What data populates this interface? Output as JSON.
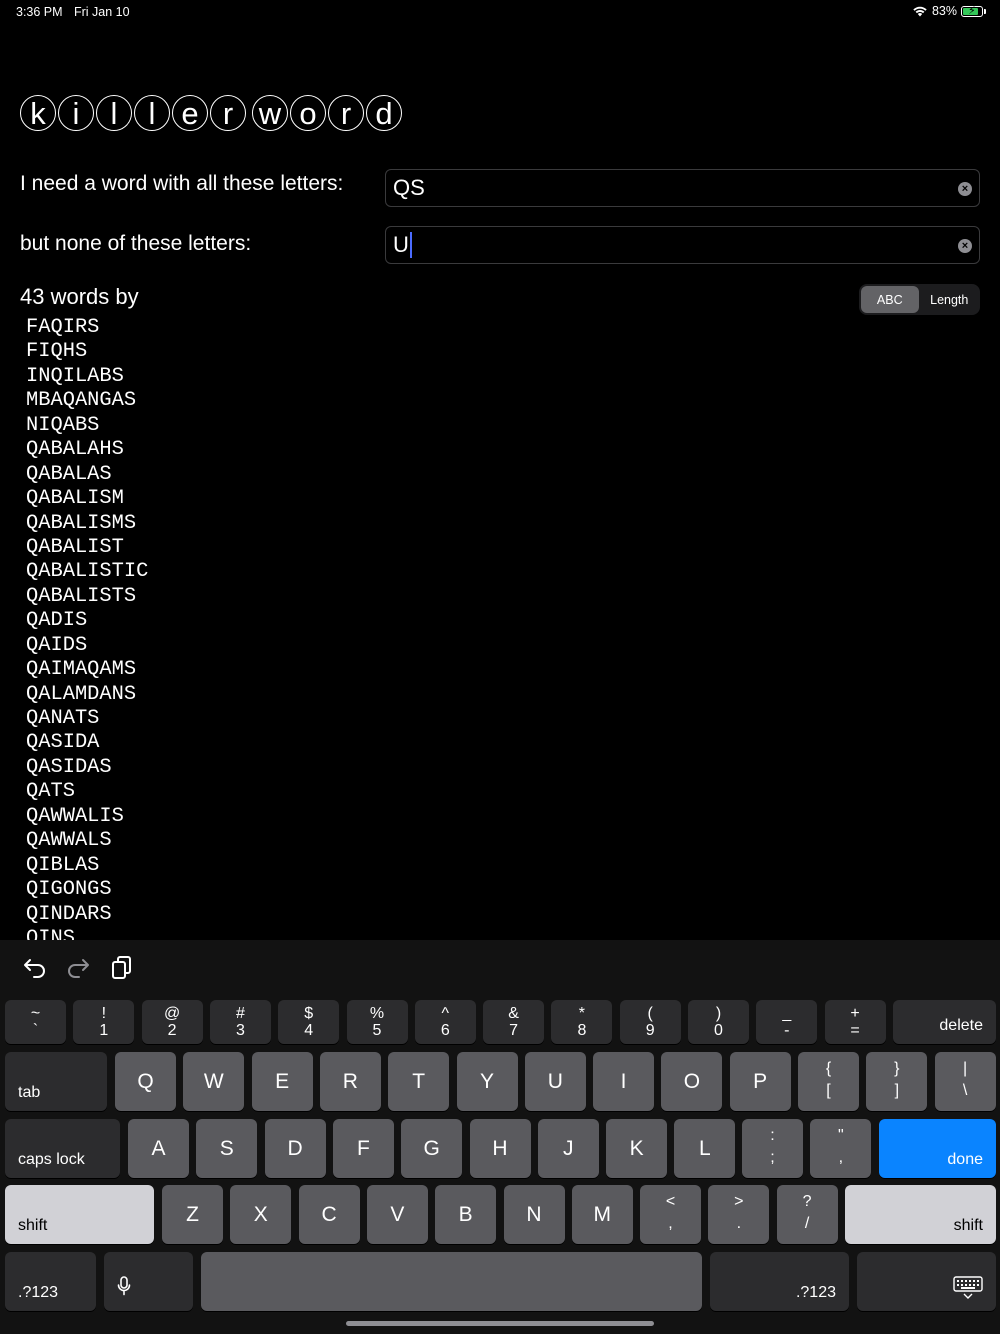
{
  "status": {
    "time": "3:36 PM",
    "date": "Fri Jan 10",
    "battery": "83%",
    "wifi_icon": "wifi-icon",
    "battery_icon": "battery-charging-icon"
  },
  "title_letters": [
    [
      "k",
      "i",
      "l",
      "l",
      "e",
      "r"
    ],
    [
      "w",
      "o",
      "r",
      "d"
    ]
  ],
  "form": {
    "include_label": "I need a word with all these letters:",
    "include_value": "QS",
    "exclude_label": "but none of these letters:",
    "exclude_value": "U"
  },
  "results": {
    "count_text": "43 words by",
    "sort_options": [
      "ABC",
      "Length"
    ],
    "selected_sort": "ABC",
    "words": [
      "FAQIRS",
      "FIQHS",
      "INQILABS",
      "MBAQANGAS",
      "NIQABS",
      "QABALAHS",
      "QABALAS",
      "QABALISM",
      "QABALISMS",
      "QABALIST",
      "QABALISTIC",
      "QABALISTS",
      "QADIS",
      "QAIDS",
      "QAIMAQAMS",
      "QALAMDANS",
      "QANATS",
      "QASIDA",
      "QASIDAS",
      "QATS",
      "QAWWALIS",
      "QAWWALS",
      "QIBLAS",
      "QIGONGS",
      "QINDARS",
      "QINS"
    ]
  },
  "keyboard": {
    "toolbar_icons": [
      "undo-icon",
      "redo-icon",
      "paste-icon"
    ],
    "row1": [
      {
        "t": "~",
        "b": "`"
      },
      {
        "t": "!",
        "b": "1"
      },
      {
        "t": "@",
        "b": "2"
      },
      {
        "t": "#",
        "b": "3"
      },
      {
        "t": "$",
        "b": "4"
      },
      {
        "t": "%",
        "b": "5"
      },
      {
        "t": "^",
        "b": "6"
      },
      {
        "t": "&",
        "b": "7"
      },
      {
        "t": "*",
        "b": "8"
      },
      {
        "t": "(",
        "b": "9"
      },
      {
        "t": ")",
        "b": "0"
      },
      {
        "t": "_",
        "b": "-"
      },
      {
        "t": "+",
        "b": "="
      }
    ],
    "delete": "delete",
    "tab": "tab",
    "row2": [
      "Q",
      "W",
      "E",
      "R",
      "T",
      "Y",
      "U",
      "I",
      "O",
      "P"
    ],
    "row2_sym": [
      {
        "t": "{",
        "b": "["
      },
      {
        "t": "}",
        "b": "]"
      },
      {
        "t": "|",
        "b": "\\"
      }
    ],
    "caps": "caps lock",
    "row3": [
      "A",
      "S",
      "D",
      "F",
      "G",
      "H",
      "J",
      "K",
      "L"
    ],
    "row3_sym": [
      {
        "t": ":",
        "b": ";"
      },
      {
        "t": "\"",
        "b": ","
      }
    ],
    "done": "done",
    "shift": "shift",
    "row4": [
      "Z",
      "X",
      "C",
      "V",
      "B",
      "N",
      "M"
    ],
    "row4_sym": [
      {
        "t": "<",
        "b": ","
      },
      {
        "t": ">",
        "b": "."
      },
      {
        "t": "?",
        "b": "/"
      }
    ],
    "numbers": ".?123",
    "mic_icon": "microphone-icon",
    "hide_icon": "keyboard-hide-icon"
  }
}
